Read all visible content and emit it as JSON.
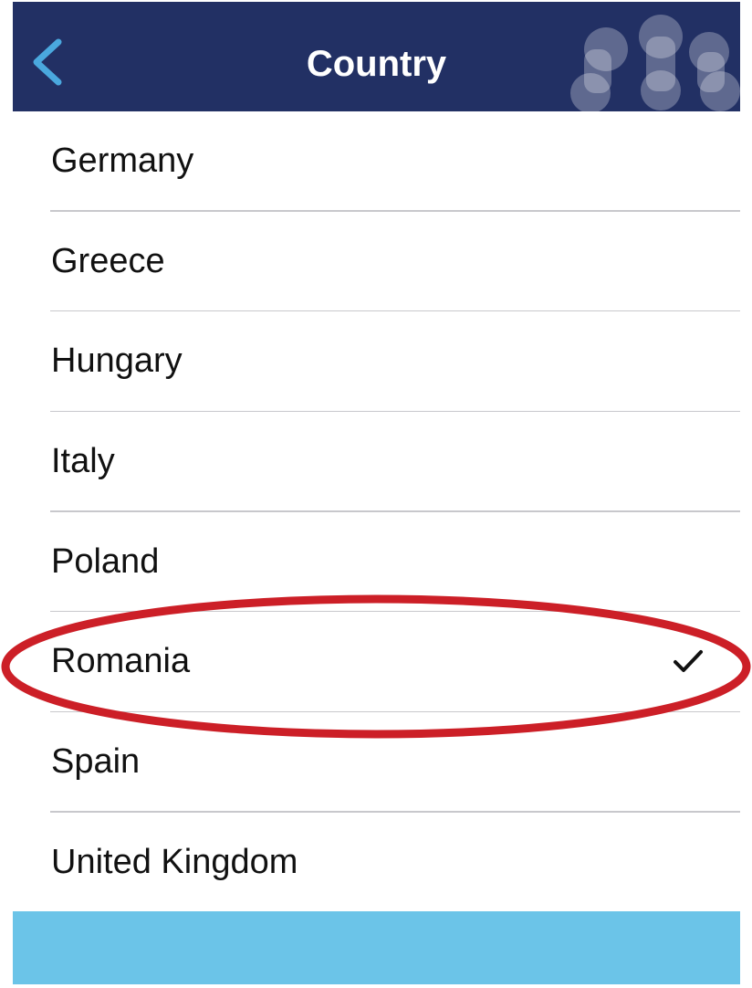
{
  "navbar": {
    "title": "Country",
    "background": "#223064",
    "back_icon": "chevron-left-icon",
    "back_icon_color": "#4aa8de",
    "logo_icon": "people-logo-icon"
  },
  "countries": [
    {
      "label": "Germany",
      "selected": false
    },
    {
      "label": "Greece",
      "selected": false
    },
    {
      "label": "Hungary",
      "selected": false
    },
    {
      "label": "Italy",
      "selected": false
    },
    {
      "label": "Poland",
      "selected": false
    },
    {
      "label": "Romania",
      "selected": true
    },
    {
      "label": "Spain",
      "selected": false
    },
    {
      "label": "United Kingdom",
      "selected": false
    }
  ],
  "selection": {
    "check_icon": "checkmark-icon",
    "highlight_color": "#cc1f27"
  },
  "bottom_bar": {
    "color": "#6bc4e8"
  }
}
